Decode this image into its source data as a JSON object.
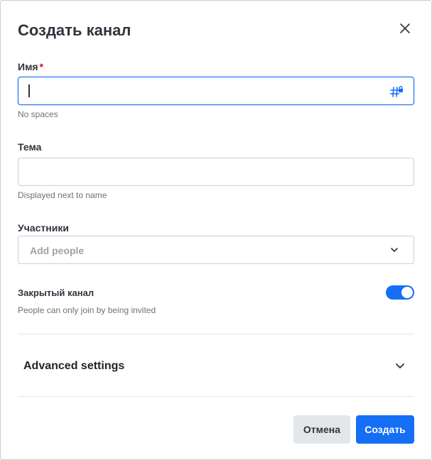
{
  "dialog": {
    "title": "Создать канал"
  },
  "name_field": {
    "label": "Имя",
    "required_mark": "*",
    "value": "",
    "hint": "No spaces",
    "icon": "hash-lock-icon"
  },
  "topic_field": {
    "label": "Тема",
    "value": "",
    "hint": "Displayed next to name"
  },
  "members_field": {
    "label": "Участники",
    "placeholder": "Add people",
    "icon": "chevron-down-icon"
  },
  "private_toggle": {
    "label": "Закрытый канал",
    "hint": "People can only join by being invited",
    "checked": true
  },
  "advanced": {
    "label": "Advanced settings",
    "icon": "chevron-down-icon"
  },
  "buttons": {
    "cancel": "Отмена",
    "create": "Создать"
  },
  "colors": {
    "primary": "#156ff5",
    "required": "#d40c26",
    "neutral_button": "#e4e7ea",
    "border": "#cbced1",
    "hint_text": "#6c727a"
  }
}
